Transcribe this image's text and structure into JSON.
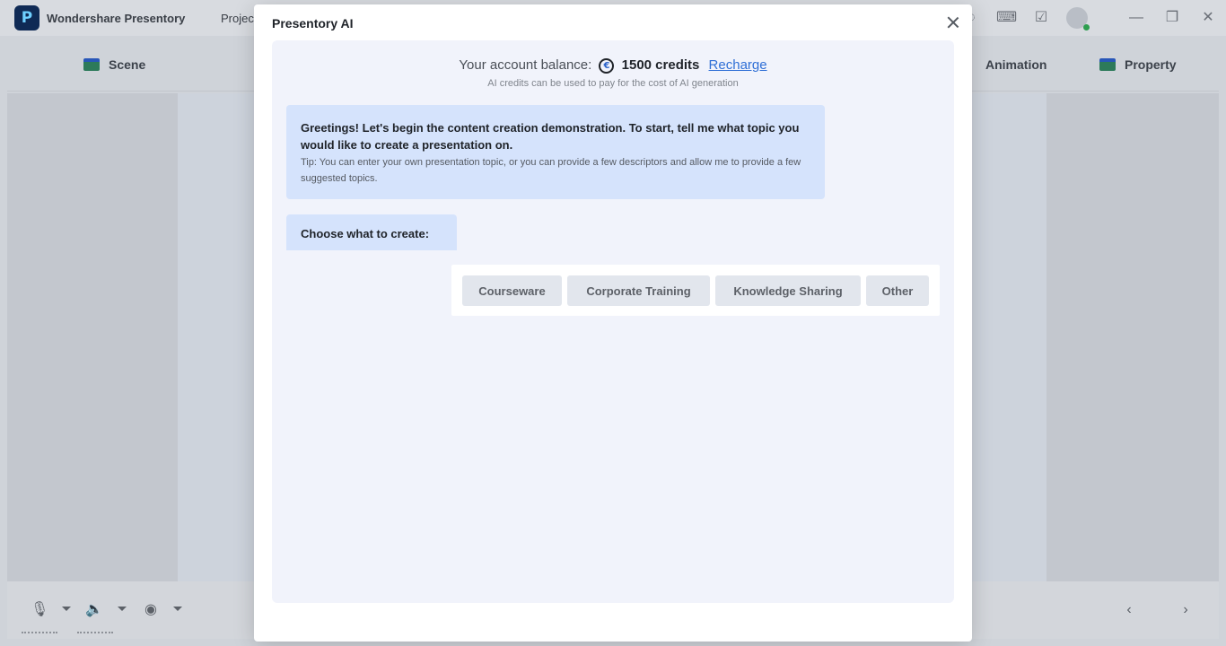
{
  "app": {
    "name": "Wondershare Presentory",
    "logo_letter": "P",
    "menu_project": "Project"
  },
  "toolbar": {
    "scene_label": "Scene",
    "animation_label": "Animation",
    "property_label": "Property"
  },
  "dialog": {
    "title": "Presentory AI",
    "balance_label": "Your account balance:",
    "coin_symbol": "€",
    "credits": "1500 credits",
    "recharge_label": "Recharge",
    "balance_note": "AI credits can be used to pay for the cost of AI generation",
    "greeting": {
      "main": "Greetings! Let's begin the content creation demonstration. To start, tell me what topic you would like to create a presentation on.",
      "tip": "Tip: You can enter your own presentation topic, or you can provide a few descriptors and allow me to provide a few suggested topics."
    },
    "choose_prompt": "Choose what to create:",
    "options": [
      "Courseware",
      "Corporate Training",
      "Knowledge Sharing",
      "Other"
    ]
  },
  "colors": {
    "bubble": "#d5e3fc",
    "panel": "#f1f3fb",
    "link": "#2f6fd6",
    "option_bg": "#e2e6ed"
  }
}
